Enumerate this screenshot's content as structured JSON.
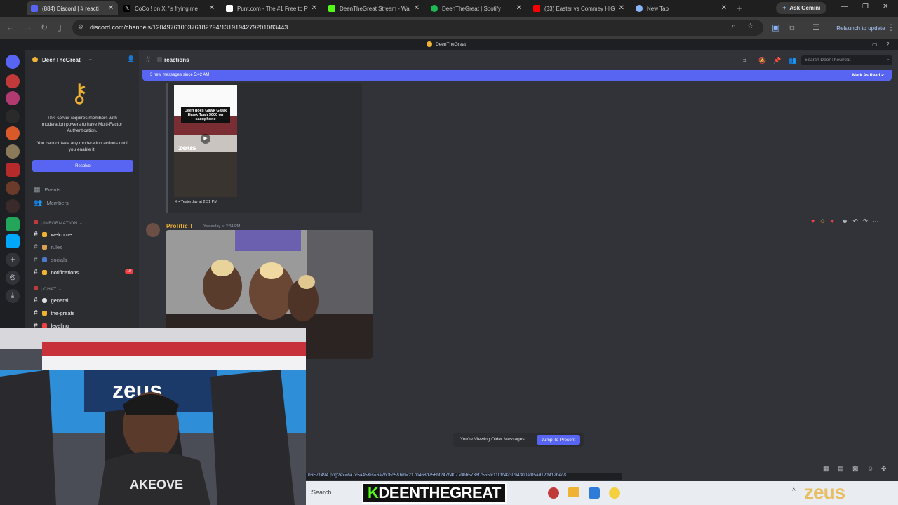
{
  "browser": {
    "tabs": [
      {
        "title": "(884) Discord | # reacti",
        "color": "#5865f2"
      },
      {
        "title": "CoCo ! on X: \"s frying me",
        "color": "#000000"
      },
      {
        "title": "Punt.com - The #1 Free to P",
        "color": "#ffffff"
      },
      {
        "title": "DeenTheGreat Stream - Wa",
        "color": "#53fc18"
      },
      {
        "title": "DeenTheGreat | Spotify",
        "color": "#1db954"
      },
      {
        "title": "(33) Easter vs Commey HIG",
        "color": "#ff0000"
      },
      {
        "title": "New Tab",
        "color": "#8ab4f8"
      }
    ],
    "gemini_label": "Ask Gemini",
    "url": "discord.com/channels/1204976100376182794/1319194279201083443",
    "relaunch_label": "Relaunch to update"
  },
  "discord": {
    "title": "DeenTheGreat",
    "server_name": "DeenTheGreat",
    "mfa_line1": "This server requires members with",
    "mfa_line2": "moderation powers to have Multi-Factor",
    "mfa_line3": "Authentication.",
    "mfa_line4": "You cannot take any moderation actions until",
    "mfa_line5": "you enable it.",
    "resolve_label": "Resolve",
    "events_label": "Events",
    "members_label": "Members",
    "cat_information": "INFORMATION",
    "cat_chat": "CHAT",
    "channels": {
      "welcome": "welcome",
      "rules": "rules",
      "socials": "socials",
      "notifications": "notifications",
      "general": "general",
      "the_greats": "the-greats",
      "leveling": "leveling"
    },
    "notif_count": "10",
    "channel_name": "reactions",
    "search_placeholder": "Search DeenTheGreat",
    "new_messages": "3 new messages since 5:42 AM",
    "mark_as_read": "Mark As Read",
    "embed_caption": "Deen goes Gawk Gawk Hawk Tuah 3000 on saxophone",
    "embed_brand": "zeus",
    "embed_footer": "X • Yesterday at 2:31 PM",
    "message_author": "Prolific!!",
    "message_time": "Yesterday at 2:34 PM",
    "older_text": "You're Viewing Older Messages",
    "jump_label": "Jump To Present",
    "status_url": "06F71494.png?ex=6a7c5a45&is=6a7b08c5&hm=2170468d756bf247b40770bb5736f7555fc110fb423094300af05ad12fbf12bec&"
  },
  "taskbar": {
    "search_label": "Search",
    "overlay_name": "DEENTHEGREAT",
    "brand": "zeus"
  }
}
